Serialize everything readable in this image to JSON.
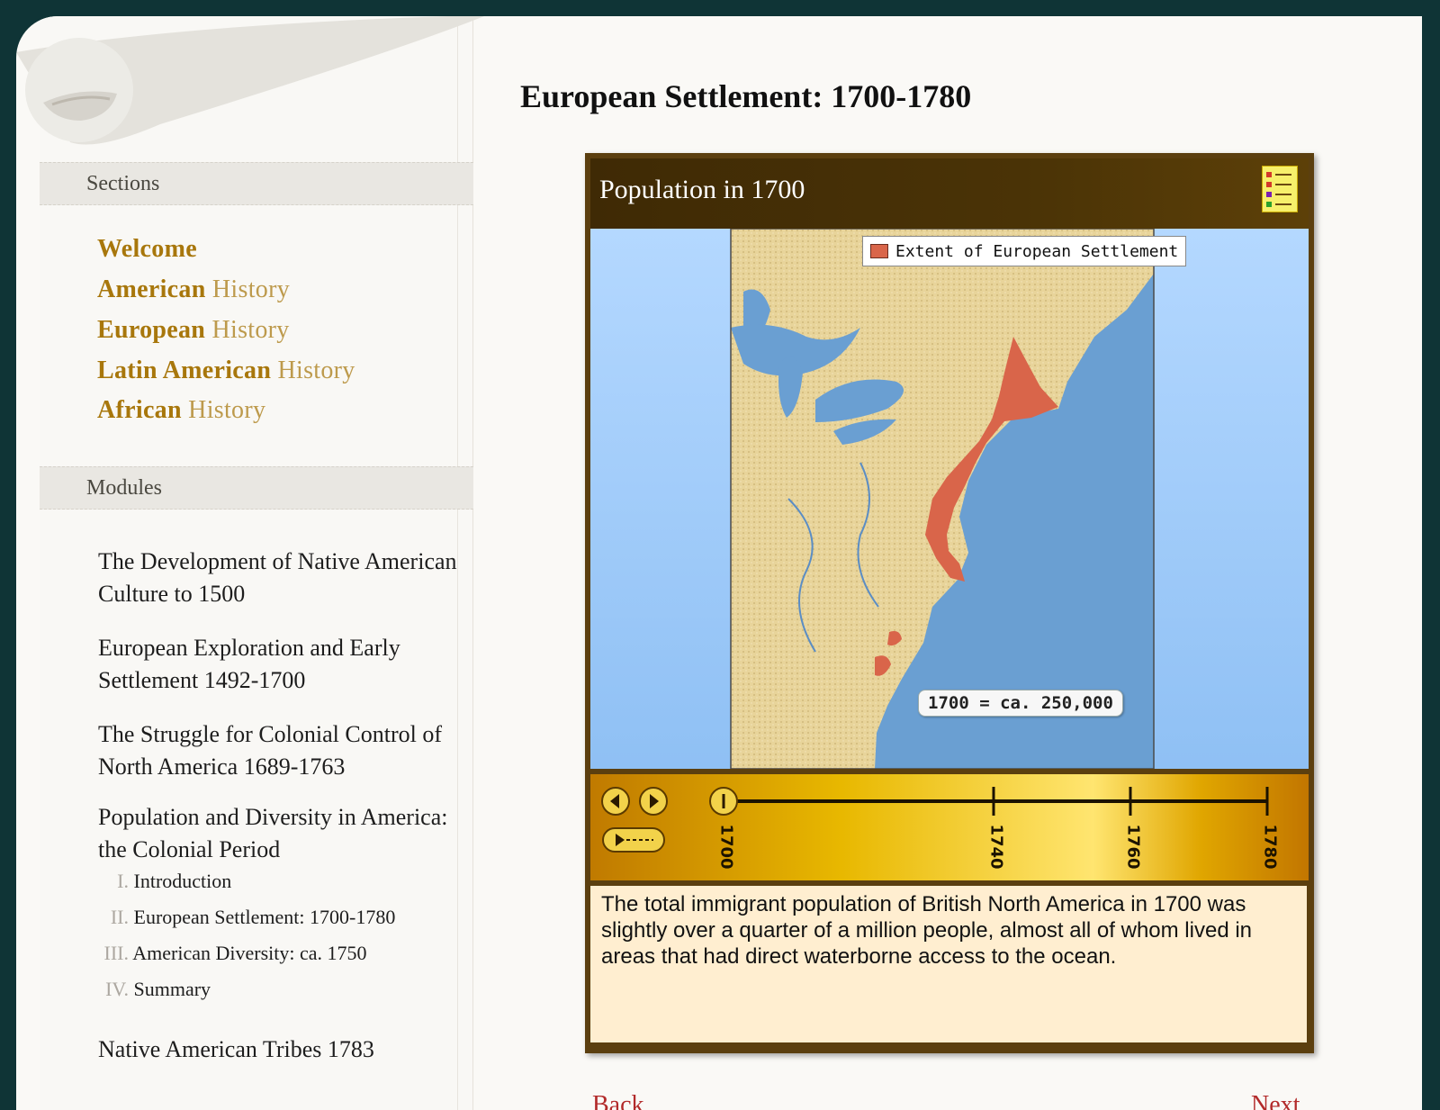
{
  "sidebar": {
    "sections_header": "Sections",
    "sections": [
      {
        "bold": "Welcome",
        "rest": ""
      },
      {
        "bold": "American",
        "rest": "History"
      },
      {
        "bold": "European",
        "rest": "History"
      },
      {
        "bold": "Latin American",
        "rest": "History"
      },
      {
        "bold": "African",
        "rest": "History"
      }
    ],
    "modules_header": "Modules",
    "modules": [
      "The Development of Native American Culture to 1500",
      "European Exploration and Early Settlement 1492-1700",
      "The Struggle for Colonial Control of North America 1689-1763",
      "Population and Diversity in America: the Colonial Period"
    ],
    "submodules": [
      {
        "num": "I.",
        "label": "Introduction"
      },
      {
        "num": "II.",
        "label": "European Settlement: 1700-1780"
      },
      {
        "num": "III.",
        "label": "American Diversity: ca. 1750"
      },
      {
        "num": "IV.",
        "label": "Summary"
      }
    ],
    "last_module": "Native American Tribes 1783"
  },
  "main": {
    "title": "European Settlement: 1700-1780",
    "widget": {
      "header": "Population in 1700",
      "legend_label": "Extent of European Settlement",
      "population_label": "1700 = ca. 250,000",
      "timeline_ticks": [
        "1700",
        "1740",
        "1760",
        "1780"
      ],
      "caption": "The total immigrant population of British North America in 1700 was slightly over a quarter of a million people, almost all of whom lived in areas that had direct waterborne access to the ocean."
    },
    "nav": {
      "back": "Back",
      "next": "Next"
    }
  },
  "colors": {
    "background": "#0f3436",
    "link_bold": "#a8770c",
    "link_light": "#bd9a4c",
    "settlement": "#d9654a",
    "land": "#e8d49a",
    "water": "#6a9fd2",
    "nav_link": "#b22a2a"
  },
  "icons": [
    "scroll-curl-icon",
    "legend-icon",
    "step-back-icon",
    "step-forward-icon",
    "play-icon",
    "timeline-handle-icon"
  ]
}
